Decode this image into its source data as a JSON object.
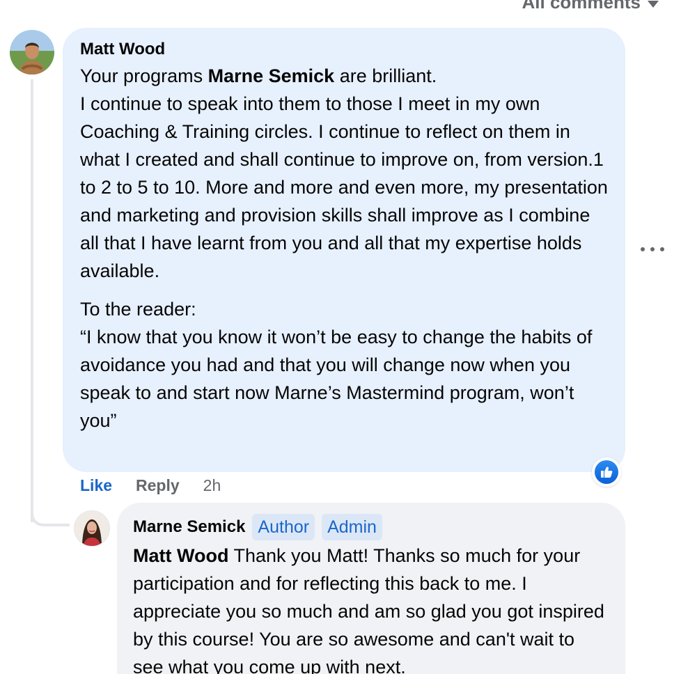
{
  "sort": {
    "label": "All comments"
  },
  "comment": {
    "author": "Matt Wood",
    "text_line1_before": "Your programs ",
    "text_line1_mention": "Marne Semick",
    "text_line1_after": " are brilliant.",
    "text_para1_rest": "I continue to speak into them to those I meet in my own Coaching & Training circles. I continue to reflect on them in what I created and shall continue to improve on, from version.1 to 2 to 5 to 10. More and more and even more, my presentation and marketing and provision skills shall improve as I combine all that I have learnt from you and all that my expertise holds available.",
    "text_para2_heading": "To the reader:",
    "text_para2_quote": "“I know that you know it won’t be easy to change the habits of avoidance you had and that you will change now when you speak to and start now Marne’s Mastermind program, won’t you”",
    "actions": {
      "like": "Like",
      "reply": "Reply",
      "time": "2h"
    },
    "reaction_icon": "thumbs-up-icon"
  },
  "reply": {
    "author": "Marne Semick",
    "badges": [
      "Author",
      "Admin"
    ],
    "mention": "Matt Wood",
    "text": " Thank you Matt! Thanks so much for your participation and for reflecting this back to me. I appreciate you so much and am so glad you got inspired by this course! You are so awesome and can't wait to see what you come up with next."
  },
  "colors": {
    "main_bubble": "#e7f0fd",
    "reply_bubble": "#f0f2f5",
    "link_blue": "#1b66c9",
    "muted_text": "#65676b"
  }
}
